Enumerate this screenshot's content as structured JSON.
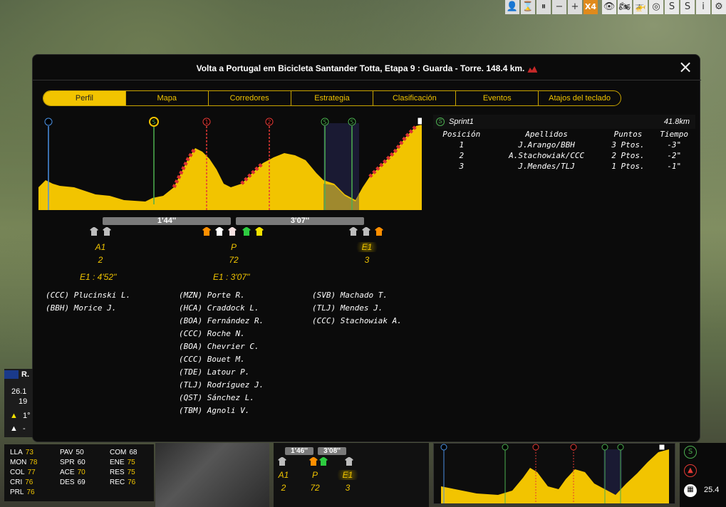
{
  "toolbar": {
    "buttons": [
      {
        "name": "profile-icon",
        "glyph": "👤"
      },
      {
        "name": "hourglass-icon",
        "glyph": "⌛"
      },
      {
        "name": "pause-icon",
        "glyph": "⏸"
      },
      {
        "name": "minus-icon",
        "glyph": "−"
      },
      {
        "name": "plus-icon",
        "glyph": "+"
      },
      {
        "name": "speed-x4",
        "glyph": "X4"
      }
    ],
    "tools": [
      {
        "name": "eye-icon",
        "glyph": "👁"
      },
      {
        "name": "motorbike-icon",
        "glyph": "🏍"
      },
      {
        "name": "helicopter-icon",
        "glyph": "🚁"
      },
      {
        "name": "target-icon",
        "glyph": "◎"
      },
      {
        "name": "sprint-icon",
        "glyph": "S"
      },
      {
        "name": "sprint-cycle-icon",
        "glyph": "S"
      },
      {
        "name": "info-icon",
        "glyph": "i"
      },
      {
        "name": "settings-icon",
        "glyph": "⚙"
      }
    ]
  },
  "dialog": {
    "title": "Volta a Portugal em Bicicleta Santander Totta, Etapa 9 : Guarda - Torre. 148.4 km.",
    "close": "×",
    "tabs": [
      "Perfil",
      "Mapa",
      "Corredores",
      "Estrategia",
      "Clasificación",
      "Eventos",
      "Atajos del teclado"
    ],
    "active_tab": "Perfil"
  },
  "profile": {
    "markers": [
      {
        "type": "start",
        "label": "▸"
      },
      {
        "type": "sprint",
        "label": "S"
      },
      {
        "type": "climb",
        "label": "1"
      },
      {
        "type": "climb",
        "label": "2"
      },
      {
        "type": "sprint",
        "label": "S"
      },
      {
        "type": "sprint",
        "label": "S"
      },
      {
        "type": "finish",
        "label": "▦"
      }
    ]
  },
  "gaps": [
    "1'44''",
    "3'07''"
  ],
  "groups": [
    {
      "label": "A1",
      "count": "2",
      "gap": "E1 : 4'52''",
      "riders": [
        "(CCC) Plucinski L.",
        "(BBH) Morice J."
      ]
    },
    {
      "label": "P",
      "count": "72",
      "gap": "E1 : 3'07''",
      "riders": [
        "(MZN) Porte R.",
        "(HCA) Craddock L.",
        "(BOA) Fernández R.",
        "(CCC) Roche N.",
        "(BOA) Chevrier C.",
        "(CCC) Bouet M.",
        "(TDE) Latour P.",
        "(TLJ) Rodríguez J.",
        "(QST) Sánchez L.",
        "(TBM) Agnoli V."
      ]
    },
    {
      "label": "E1",
      "count": "3",
      "gap": "",
      "riders": [
        "(SVB) Machado T.",
        "(TLJ) Mendes J.",
        "(CCC) Stachowiak A."
      ]
    }
  ],
  "sprint": {
    "name": "Sprint1",
    "distance": "41.8km",
    "headers": [
      "Posición",
      "Apellidos",
      "Puntos",
      "Tiempo"
    ],
    "rows": [
      [
        "1",
        "J.Arango/BBH",
        "3 Ptos.",
        "-3\""
      ],
      [
        "2",
        "A.Stachowiak/CCC",
        "2 Ptos.",
        "-2\""
      ],
      [
        "3",
        "J.Mendes/TLJ",
        "1 Ptos.",
        "-1\""
      ]
    ]
  },
  "rider_card": {
    "name": "R.",
    "value1": "26.1",
    "value2": "19",
    "rank1": "1°",
    "rank2": "-"
  },
  "stats": [
    {
      "k": "LLA",
      "v": "73"
    },
    {
      "k": "PAV",
      "v": "50"
    },
    {
      "k": "COM",
      "v": "68"
    },
    {
      "k": "MON",
      "v": "78"
    },
    {
      "k": "SPR",
      "v": "60"
    },
    {
      "k": "ENE",
      "v": "75"
    },
    {
      "k": "COL",
      "v": "77"
    },
    {
      "k": "ACE",
      "v": "70"
    },
    {
      "k": "RES",
      "v": "75"
    },
    {
      "k": "CRI",
      "v": "76"
    },
    {
      "k": "DES",
      "v": "69"
    },
    {
      "k": "REC",
      "v": "76"
    },
    {
      "k": "PRL",
      "v": "76"
    }
  ],
  "mini": {
    "gaps": [
      "1'46''",
      "3'08''"
    ],
    "labels": [
      "A1",
      "P",
      "E1"
    ],
    "counts": [
      "2",
      "72",
      "3"
    ],
    "side_value": "25.4"
  },
  "colors": {
    "accent": "#f2c400",
    "sprint": "#4caf50",
    "climb": "#e53935",
    "finish_bg": "#0b0b0b"
  }
}
